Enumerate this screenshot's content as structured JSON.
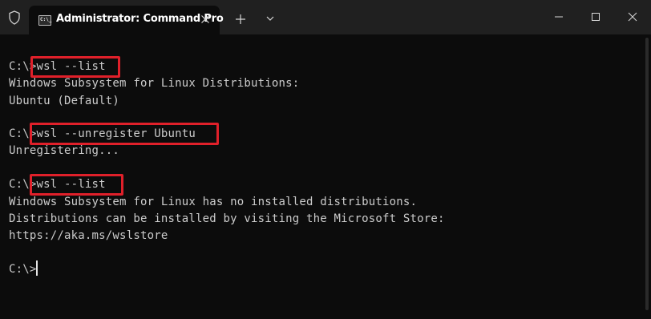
{
  "tab": {
    "title": "Administrator: Command Pro",
    "icon_text": "C:\\_"
  },
  "icons": {
    "shield": "shield-icon",
    "close_tab": "close-icon",
    "new_tab": "plus-icon",
    "dropdown": "chevron-down-icon",
    "minimize": "minimize-icon",
    "maximize": "maximize-icon",
    "close_window": "close-icon"
  },
  "colors": {
    "background": "#0c0c0c",
    "titlebar": "#202020",
    "text": "#cccccc",
    "highlight": "#e0202a"
  },
  "terminal": {
    "lines": [
      "C:\\>wsl --list",
      "Windows Subsystem for Linux Distributions:",
      "Ubuntu (Default)",
      "",
      "C:\\>wsl --unregister Ubuntu",
      "Unregistering...",
      "",
      "C:\\>wsl --list",
      "Windows Subsystem for Linux has no installed distributions.",
      "Distributions can be installed by visiting the Microsoft Store:",
      "https://aka.ms/wslstore",
      "",
      "C:\\>"
    ]
  }
}
